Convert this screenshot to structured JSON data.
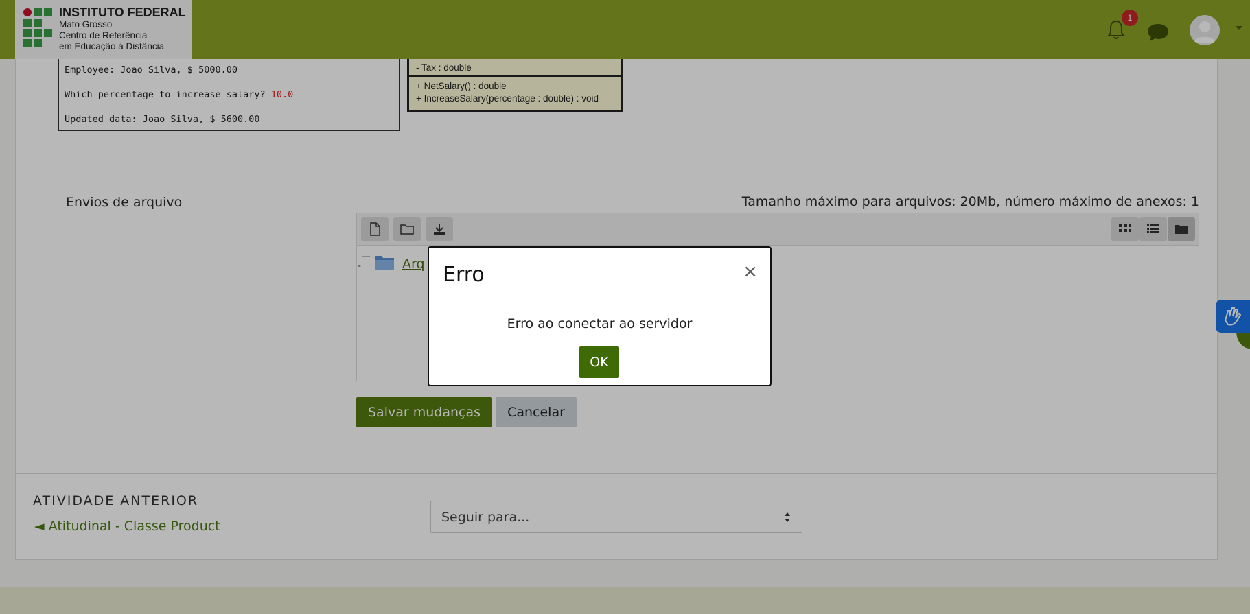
{
  "brand": {
    "title": "INSTITUTO FEDERAL",
    "line1": "Mato Grosso",
    "line2": "Centro de Referência",
    "line3": "em Educação à Distância"
  },
  "navbar": {
    "notification_count": "1",
    "bell_icon": "bell-icon",
    "chat_icon": "chat-bubble-icon",
    "avatar_icon": "user-avatar-icon"
  },
  "console": {
    "line1": "Employee: Joao Silva, $ 5000.00",
    "line2_prefix": "Which percentage to increase salary? ",
    "line2_value": "10.0",
    "line3": "Updated data: Joao Silva, $ 5600.00"
  },
  "uml": {
    "attr": "- Tax : double",
    "method1": "+ NetSalary() : double",
    "method2": "+ IncreaseSalary(percentage : double) : void"
  },
  "submission": {
    "label": "Envios de arquivo",
    "max_info": "Tamanho máximo para arquivos: 20Mb, número máximo de anexos: 1",
    "folder_label": "Arq"
  },
  "buttons": {
    "save": "Salvar mudanças",
    "cancel": "Cancelar"
  },
  "navigation": {
    "prev_heading": "ATIVIDADE ANTERIOR",
    "prev_link": "◄ Atitudinal - Classe Product",
    "jump_placeholder": "Seguir para..."
  },
  "modal": {
    "title": "Erro",
    "close": "×",
    "message": "Erro ao conectar ao servidor",
    "ok": "OK"
  },
  "colors": {
    "navbar": "#89a124",
    "primary_button": "#557a10",
    "ok_button": "#3f6b07",
    "badge": "#c62828",
    "accessibility": "#1a73e8"
  }
}
